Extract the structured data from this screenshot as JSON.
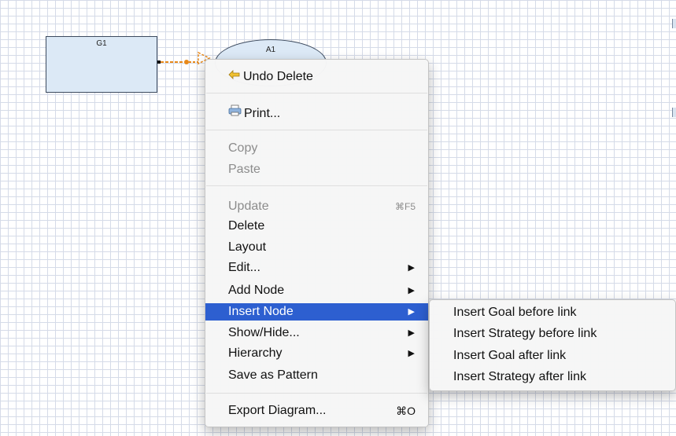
{
  "diagram": {
    "goal_label": "G1",
    "assumption_label": "A1"
  },
  "context_menu": {
    "undo_delete": "Undo Delete",
    "print": "Print...",
    "copy": "Copy",
    "paste": "Paste",
    "update": "Update",
    "update_shortcut": "⌘F5",
    "delete": "Delete",
    "layout": "Layout",
    "edit": "Edit...",
    "add_node": "Add Node",
    "insert_node": "Insert Node",
    "show_hide": "Show/Hide...",
    "hierarchy": "Hierarchy",
    "save_as_pattern": "Save as Pattern",
    "export_diagram": "Export Diagram...",
    "export_shortcut": "⌘O",
    "submenu_arrow": "▶"
  },
  "insert_node_submenu": {
    "items": [
      "Insert Goal before link",
      "Insert Strategy before link",
      "Insert Goal after link",
      "Insert Strategy after link"
    ]
  },
  "colors": {
    "highlight": "#2d5fd0",
    "node_fill": "#dce9f6",
    "connector": "#e8891a"
  },
  "icons": {
    "undo": "undo-arrow-icon",
    "print": "printer-icon"
  }
}
